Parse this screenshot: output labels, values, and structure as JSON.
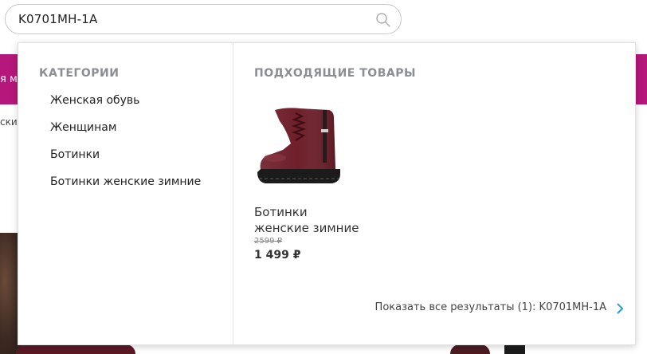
{
  "search": {
    "value": "K0701MH-1A"
  },
  "background": {
    "banner_text": "я ма",
    "breadcrumb_text": "ски"
  },
  "dropdown": {
    "categories_title": "КАТЕГОРИИ",
    "categories": [
      {
        "label": "Женская обувь"
      },
      {
        "label": "Женщинам"
      },
      {
        "label": "Ботинки"
      },
      {
        "label": "Ботинки женские зимние"
      }
    ],
    "products_title": "ПОДХОДЯЩИЕ ТОВАРЫ",
    "products": [
      {
        "name": "Ботинки женские зимние",
        "old_price": "2599 ₽",
        "price": "1 499 ₽"
      }
    ],
    "show_all_label": "Показать все результаты (1): K0701MH-1A"
  },
  "colors": {
    "banner": "#b5177a",
    "section_title": "#8a8f96",
    "chevron": "#2a9fd6"
  },
  "icons": {
    "search": "search-icon",
    "chevron": "chevron-right-icon"
  }
}
